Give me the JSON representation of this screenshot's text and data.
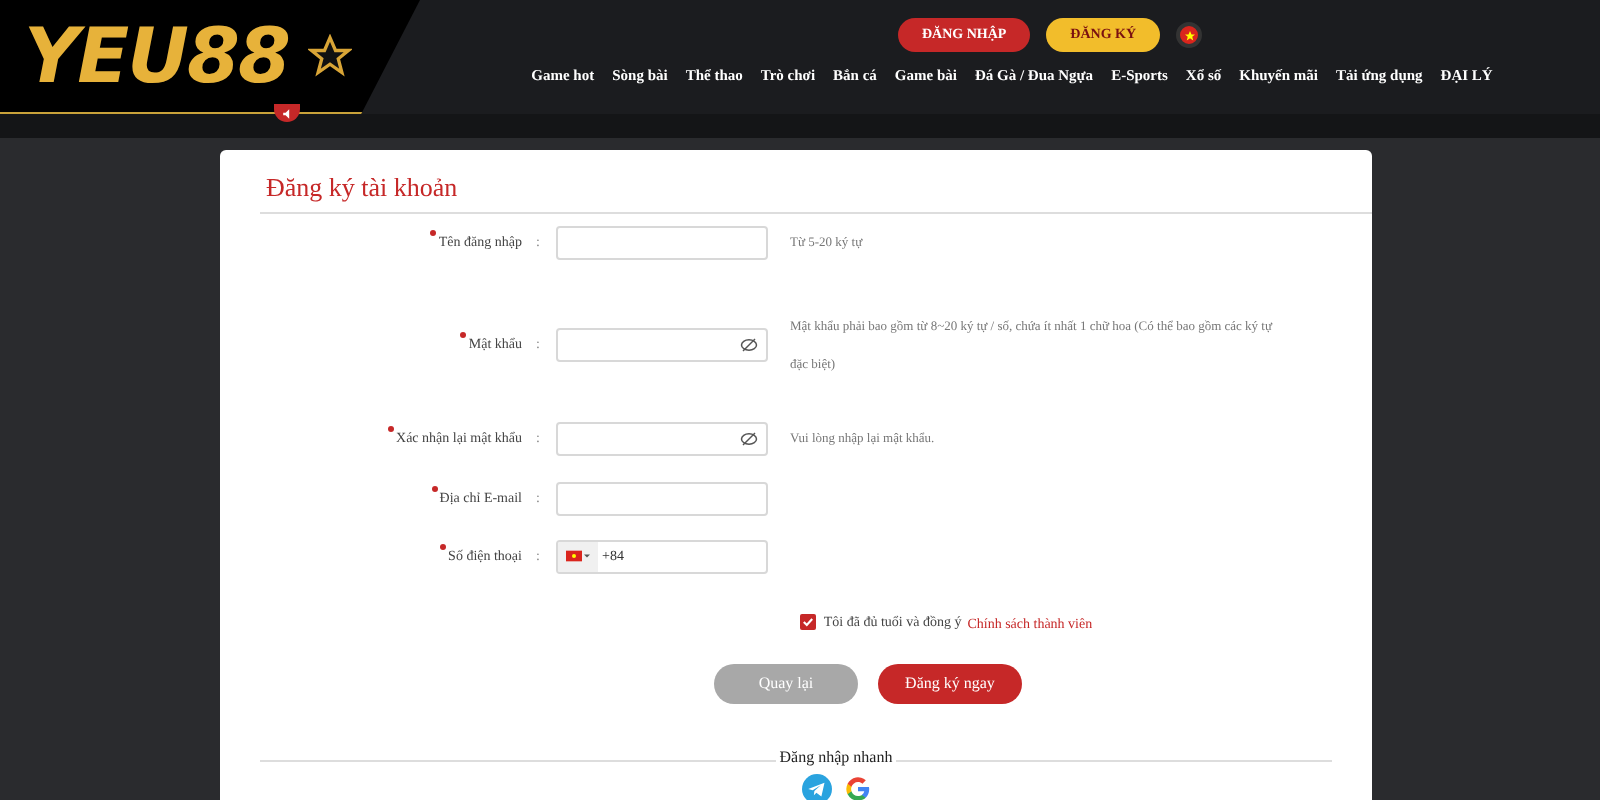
{
  "header": {
    "logo": "YEU88",
    "auth_buttons": [
      {
        "label": "ĐĂNG NHẬP",
        "kind": "login"
      },
      {
        "label": "ĐĂNG KÝ",
        "kind": "register"
      }
    ],
    "nav": [
      "Game hot",
      "Sòng bài",
      "Thể thao",
      "Trò chơi",
      "Bắn cá",
      "Game bài",
      "Đá Gà / Đua Ngựa",
      "E-Sports",
      "Xổ số",
      "Khuyến mãi",
      "Tải ứng dụng",
      "ĐẠI LÝ"
    ]
  },
  "form": {
    "title": "Đăng ký tài khoản",
    "fields": [
      {
        "label": "Tên đăng nhập",
        "separator": ":",
        "required": true,
        "kind": "text",
        "hint": "Từ 5-20 ký tự"
      },
      {
        "label": "Mật khẩu",
        "separator": ":",
        "required": true,
        "kind": "password",
        "hint": "Mật khẩu phải bao gồm từ 8~20 ký tự / số, chứa ít nhất 1 chữ hoa (Có thể bao gồm các ký tự đặc biệt)"
      },
      {
        "label": "Xác nhận lại mật khẩu",
        "separator": ":",
        "required": true,
        "kind": "password",
        "hint": "Vui lòng nhập lại mật khẩu."
      },
      {
        "label": "Địa chỉ E-mail",
        "separator": ":",
        "required": true,
        "kind": "text"
      },
      {
        "label": "Số điện thoại",
        "separator": ":",
        "required": true,
        "kind": "phone",
        "value": "+84"
      }
    ],
    "agreement": {
      "checked": true,
      "text": "Tôi đã đủ tuổi và đồng ý",
      "link": "Chính sách thành viên"
    },
    "buttons": [
      {
        "label": "Quay lại",
        "kind": "back"
      },
      {
        "label": "Đăng ký ngay",
        "kind": "submit"
      }
    ],
    "quick_login": {
      "title": "Đăng nhập nhanh"
    }
  }
}
